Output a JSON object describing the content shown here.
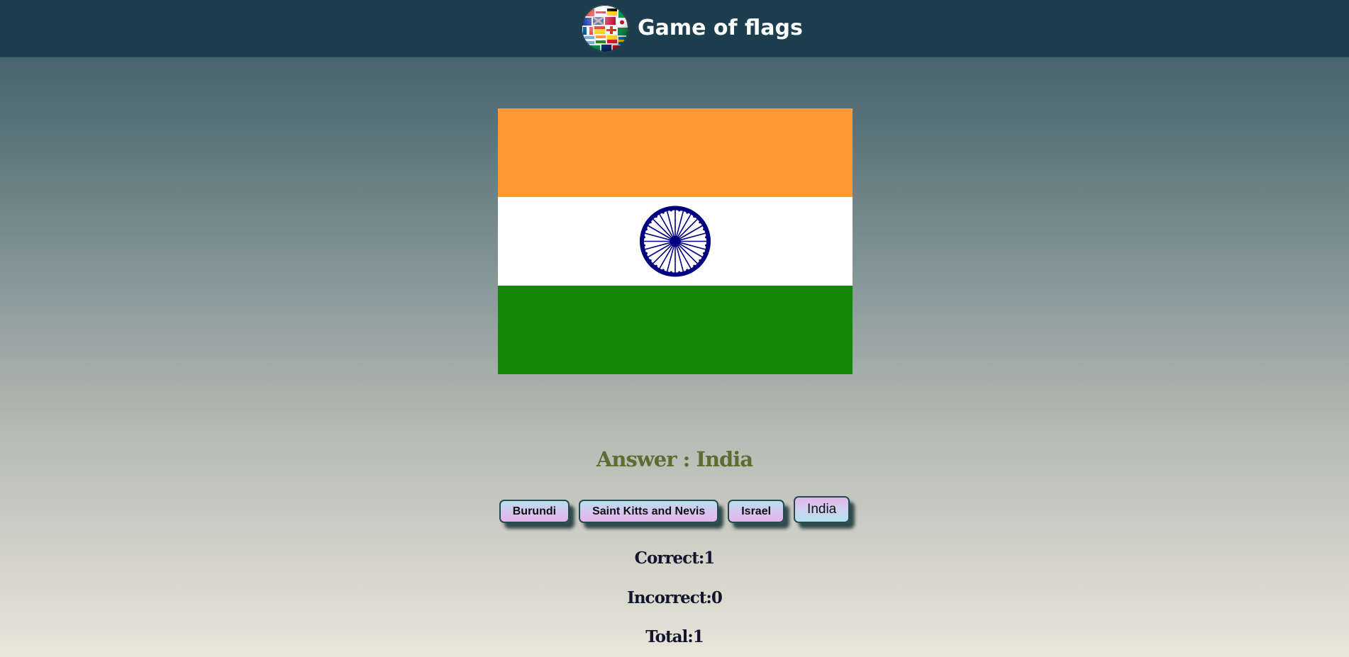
{
  "header": {
    "title": "Game of flags",
    "logo_icon": "flags-globe-icon",
    "background": "#1c3e4e"
  },
  "flag": {
    "country": "India",
    "stripes": [
      "#ff9933",
      "#ffffff",
      "#138808"
    ],
    "chakra_color": "#000080",
    "chakra_spokes": 24
  },
  "answer": {
    "label": "Answer : India",
    "color": "#5b6d30"
  },
  "options": [
    {
      "label": "Burundi",
      "selected": false
    },
    {
      "label": "Saint Kitts and Nevis",
      "selected": false
    },
    {
      "label": "Israel",
      "selected": false
    },
    {
      "label": "India",
      "selected": true
    }
  ],
  "score": {
    "correct": "Correct:1",
    "incorrect": "Incorrect:0",
    "total": "Total:1"
  }
}
